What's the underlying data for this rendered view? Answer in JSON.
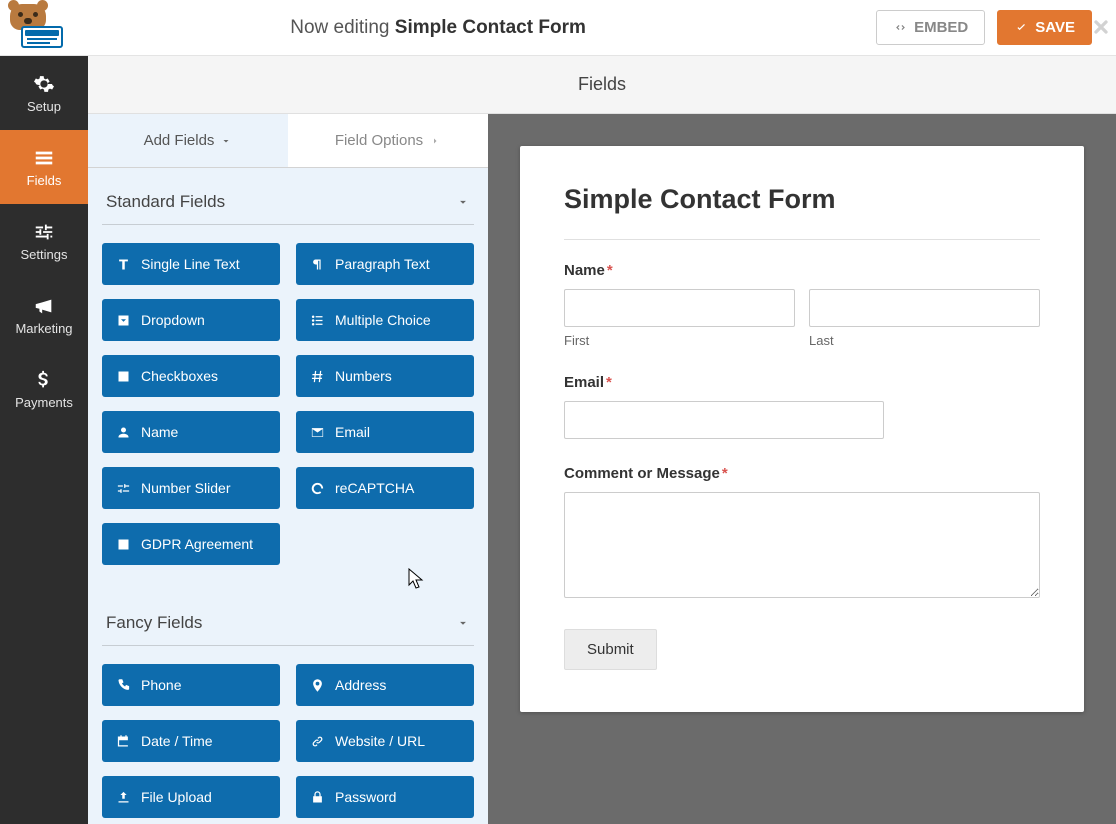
{
  "header": {
    "editing_prefix": "Now editing ",
    "form_name": "Simple Contact Form",
    "embed_label": "EMBED",
    "save_label": "SAVE"
  },
  "rail": {
    "setup": "Setup",
    "fields": "Fields",
    "settings": "Settings",
    "marketing": "Marketing",
    "payments": "Payments"
  },
  "fields_header": "Fields",
  "panel_tabs": {
    "add": "Add Fields",
    "options": "Field Options"
  },
  "sections": {
    "standard": "Standard Fields",
    "fancy": "Fancy Fields"
  },
  "standard_fields": {
    "single_line_text": "Single Line Text",
    "paragraph_text": "Paragraph Text",
    "dropdown": "Dropdown",
    "multiple_choice": "Multiple Choice",
    "checkboxes": "Checkboxes",
    "numbers": "Numbers",
    "name": "Name",
    "email": "Email",
    "number_slider": "Number Slider",
    "recaptcha": "reCAPTCHA",
    "gdpr": "GDPR Agreement"
  },
  "fancy_fields": {
    "phone": "Phone",
    "address": "Address",
    "date_time": "Date / Time",
    "website_url": "Website / URL",
    "file_upload": "File Upload",
    "password": "Password"
  },
  "form": {
    "title": "Simple Contact Form",
    "name_label": "Name",
    "first_label": "First",
    "last_label": "Last",
    "email_label": "Email",
    "message_label": "Comment or Message",
    "submit": "Submit"
  }
}
